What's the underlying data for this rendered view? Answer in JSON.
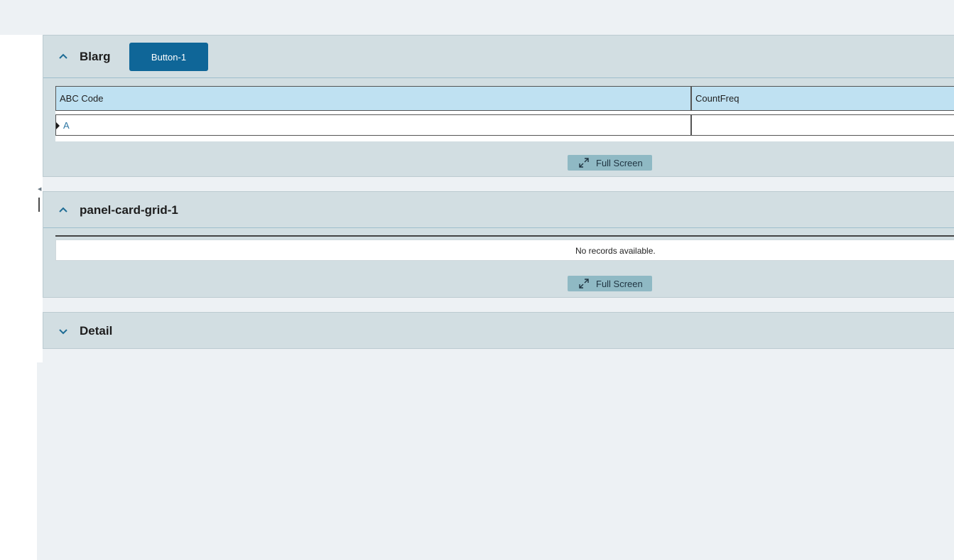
{
  "panels": [
    {
      "title": "Blarg",
      "expanded": true,
      "button_label": "Button-1",
      "grid": {
        "columns": [
          "ABC Code",
          "CountFreq"
        ],
        "rows": [
          [
            "A",
            ""
          ]
        ]
      },
      "fullscreen_label": "Full Screen"
    },
    {
      "title": "panel-card-grid-1",
      "expanded": true,
      "empty_message": "No records available.",
      "fullscreen_label": "Full Screen"
    },
    {
      "title": "Detail",
      "expanded": false
    }
  ],
  "colors": {
    "panel_bg": "#d2dee2",
    "primary_button": "#0f6698",
    "grid_header": "#bfe1f2",
    "fullscreen_button": "#8fb9c4",
    "page_bg": "#edf1f4"
  }
}
